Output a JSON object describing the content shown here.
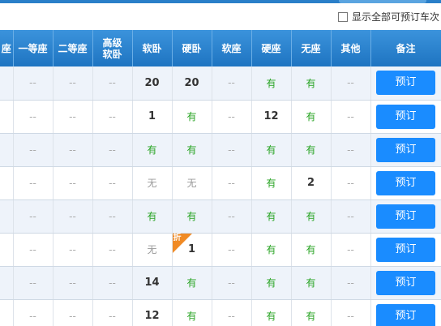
{
  "top_option": {
    "label": "显示全部可预订车次"
  },
  "headers": [
    "座",
    "一等座",
    "二等座",
    "高级\n软卧",
    "软卧",
    "硬卧",
    "软座",
    "硬座",
    "无座",
    "其他",
    "备注"
  ],
  "book_label": "预订",
  "discount_label": "折",
  "rows": [
    [
      "",
      "--",
      "--",
      "--",
      "20",
      "20",
      "--",
      "有",
      "有",
      "--"
    ],
    [
      "",
      "--",
      "--",
      "--",
      "1",
      "有",
      "--",
      "12",
      "有",
      "--"
    ],
    [
      "",
      "--",
      "--",
      "--",
      "有",
      "有",
      "--",
      "有",
      "有",
      "--"
    ],
    [
      "",
      "--",
      "--",
      "--",
      "无",
      "无",
      "--",
      "有",
      "2",
      "--"
    ],
    [
      "",
      "--",
      "--",
      "--",
      "有",
      "有",
      "--",
      "有",
      "有",
      "--"
    ],
    [
      "",
      "--",
      "--",
      "--",
      "无",
      "1",
      "--",
      "有",
      "有",
      "--"
    ],
    [
      "",
      "--",
      "--",
      "--",
      "14",
      "有",
      "--",
      "有",
      "有",
      "--"
    ],
    [
      "",
      "--",
      "--",
      "--",
      "12",
      "有",
      "--",
      "有",
      "有",
      "--"
    ]
  ],
  "discount_cells": [
    [
      5,
      5
    ]
  ],
  "colors": {
    "header": "#2a7fc9",
    "book_button": "#1a8cff",
    "available": "#26a321",
    "discount": "#f08a24"
  }
}
